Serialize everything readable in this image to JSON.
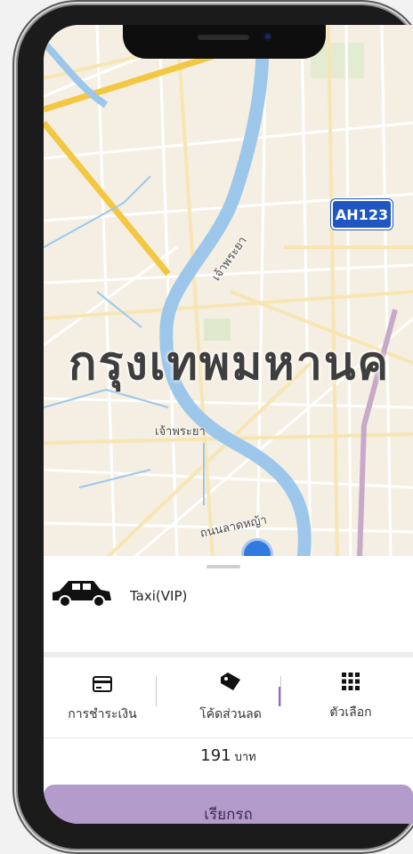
{
  "map": {
    "city_label": "กรุงเทพมหานค",
    "road_shield": "AH123",
    "river_labels": [
      "เจ้าพระยา",
      "เจ้าพระยา"
    ],
    "street_label": "ถนนลาดหญ้า",
    "colors": {
      "land": "#f4efe2",
      "river": "#9dc7ea",
      "major_road": "#f3c742",
      "minor_road": "#ffffff"
    }
  },
  "vehicle": {
    "name": "Taxi(VIP)",
    "icon": "taxi-icon"
  },
  "options": [
    {
      "label": "การชำระเงิน",
      "icon": "credit-card-icon"
    },
    {
      "label": "โค้ดส่วนลด",
      "icon": "tag-icon"
    },
    {
      "label": "ตัวเลือก",
      "icon": "grid-icon"
    }
  ],
  "fare": {
    "amount": "191",
    "unit": "บาท"
  },
  "cta": {
    "label": "เรียกรถ",
    "color": "#b39bcc"
  }
}
